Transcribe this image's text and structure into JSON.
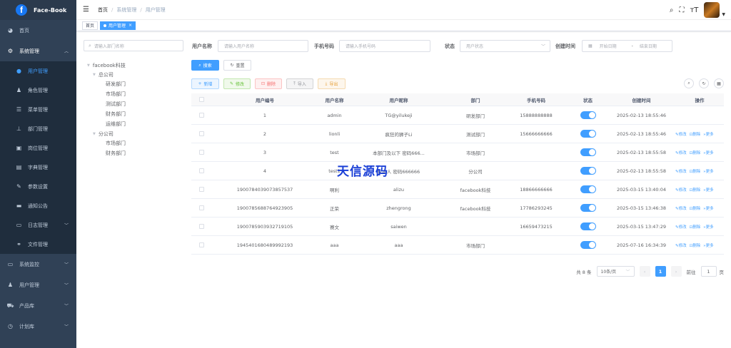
{
  "app": {
    "logo_letter": "f",
    "title": "Face-Book"
  },
  "sidebar": {
    "items": [
      {
        "label": "首页",
        "icon": "dashboard-icon"
      },
      {
        "label": "系统管理",
        "icon": "gear-icon"
      },
      {
        "label": "用户管理",
        "icon": "user-icon"
      },
      {
        "label": "角色管理",
        "icon": "role-icon"
      },
      {
        "label": "菜单管理",
        "icon": "tree-table-icon"
      },
      {
        "label": "部门管理",
        "icon": "org-tree-icon"
      },
      {
        "label": "岗位管理",
        "icon": "post-icon"
      },
      {
        "label": "字典管理",
        "icon": "dict-icon"
      },
      {
        "label": "参数设置",
        "icon": "edit-icon"
      },
      {
        "label": "通知公告",
        "icon": "message-icon"
      },
      {
        "label": "日志管理",
        "icon": "log-icon"
      },
      {
        "label": "文件管理",
        "icon": "file-icon"
      },
      {
        "label": "系统监控",
        "icon": "monitor-icon"
      },
      {
        "label": "用户管理",
        "icon": "users-icon"
      },
      {
        "label": "产品库",
        "icon": "cart-icon"
      },
      {
        "label": "计划库",
        "icon": "clock-icon"
      }
    ]
  },
  "header": {
    "breadcrumb": [
      "首页",
      "系统管理",
      "用户管理"
    ],
    "sep": "/"
  },
  "tags": [
    {
      "label": "首页"
    },
    {
      "label": "用户管理",
      "close": "×"
    }
  ],
  "dept": {
    "search_placeholder": "请输入部门名称",
    "tree": [
      "facebook科技",
      "总公司",
      "研发部门",
      "市场部门",
      "测试部门",
      "财务部门",
      "运维部门",
      "分公司",
      "市场部门",
      "财务部门"
    ]
  },
  "search": {
    "username_label": "用户名称",
    "username_ph": "请输入用户名称",
    "phone_label": "手机号码",
    "phone_ph": "请输入手机号码",
    "status_label": "状态",
    "status_ph": "用户状态",
    "time_label": "创建时间",
    "start_ph": "开始日期",
    "range_sep": "-",
    "end_ph": "结束日期",
    "search_btn": "搜索",
    "reset_btn": "重置"
  },
  "toolbar": {
    "add": "新增",
    "edit": "修改",
    "delete": "删除",
    "import": "导入",
    "export": "导出"
  },
  "table": {
    "headers": [
      "用户编号",
      "用户名称",
      "用户昵称",
      "部门",
      "手机号码",
      "状态",
      "创建时间",
      "操作"
    ],
    "rows": [
      {
        "id": "1",
        "name": "admin",
        "nick": "TG@yilukeji",
        "dept": "研发部门",
        "phone": "15888888888",
        "status": true,
        "time": "2025-02-13 18:55:46",
        "ops": false
      },
      {
        "id": "2",
        "name": "lionli",
        "nick": "疯狂的狮子Li",
        "dept": "测试部门",
        "phone": "15666666666",
        "status": true,
        "time": "2025-02-13 18:55:46",
        "ops": true
      },
      {
        "id": "3",
        "name": "test",
        "nick": "本部门及以下 密码666...",
        "dept": "市场部门",
        "phone": "",
        "status": true,
        "time": "2025-02-13 18:55:58",
        "ops": true
      },
      {
        "id": "4",
        "name": "test1",
        "nick": "仅本人 密码666666",
        "dept": "分公司",
        "phone": "",
        "status": true,
        "time": "2025-02-13 18:55:58",
        "ops": true
      },
      {
        "id": "1900784039073857537",
        "name": "啊利",
        "nick": "alizu",
        "dept": "facebook科技",
        "phone": "18866666666",
        "status": true,
        "time": "2025-03-15 13:40:04",
        "ops": true
      },
      {
        "id": "1900785688764923905",
        "name": "正荣",
        "nick": "zhengrong",
        "dept": "facebook科技",
        "phone": "17786293245",
        "status": true,
        "time": "2025-03-15 13:46:38",
        "ops": true
      },
      {
        "id": "1900785903932719105",
        "name": "赛文",
        "nick": "saiwen",
        "dept": "",
        "phone": "16659473215",
        "status": true,
        "time": "2025-03-15 13:47:29",
        "ops": true
      },
      {
        "id": "1945401680489992193",
        "name": "aaa",
        "nick": "aaa",
        "dept": "市场部门",
        "phone": "",
        "status": true,
        "time": "2025-07-16 16:34:39",
        "ops": true
      }
    ],
    "op_edit": "修改",
    "op_delete": "删除",
    "op_more": "更多"
  },
  "pagination": {
    "total": "共 8 条",
    "page_size": "10条/页",
    "current": "1",
    "goto_label": "前往",
    "goto_value": "1",
    "page_unit": "页"
  },
  "watermark": "天信源码"
}
